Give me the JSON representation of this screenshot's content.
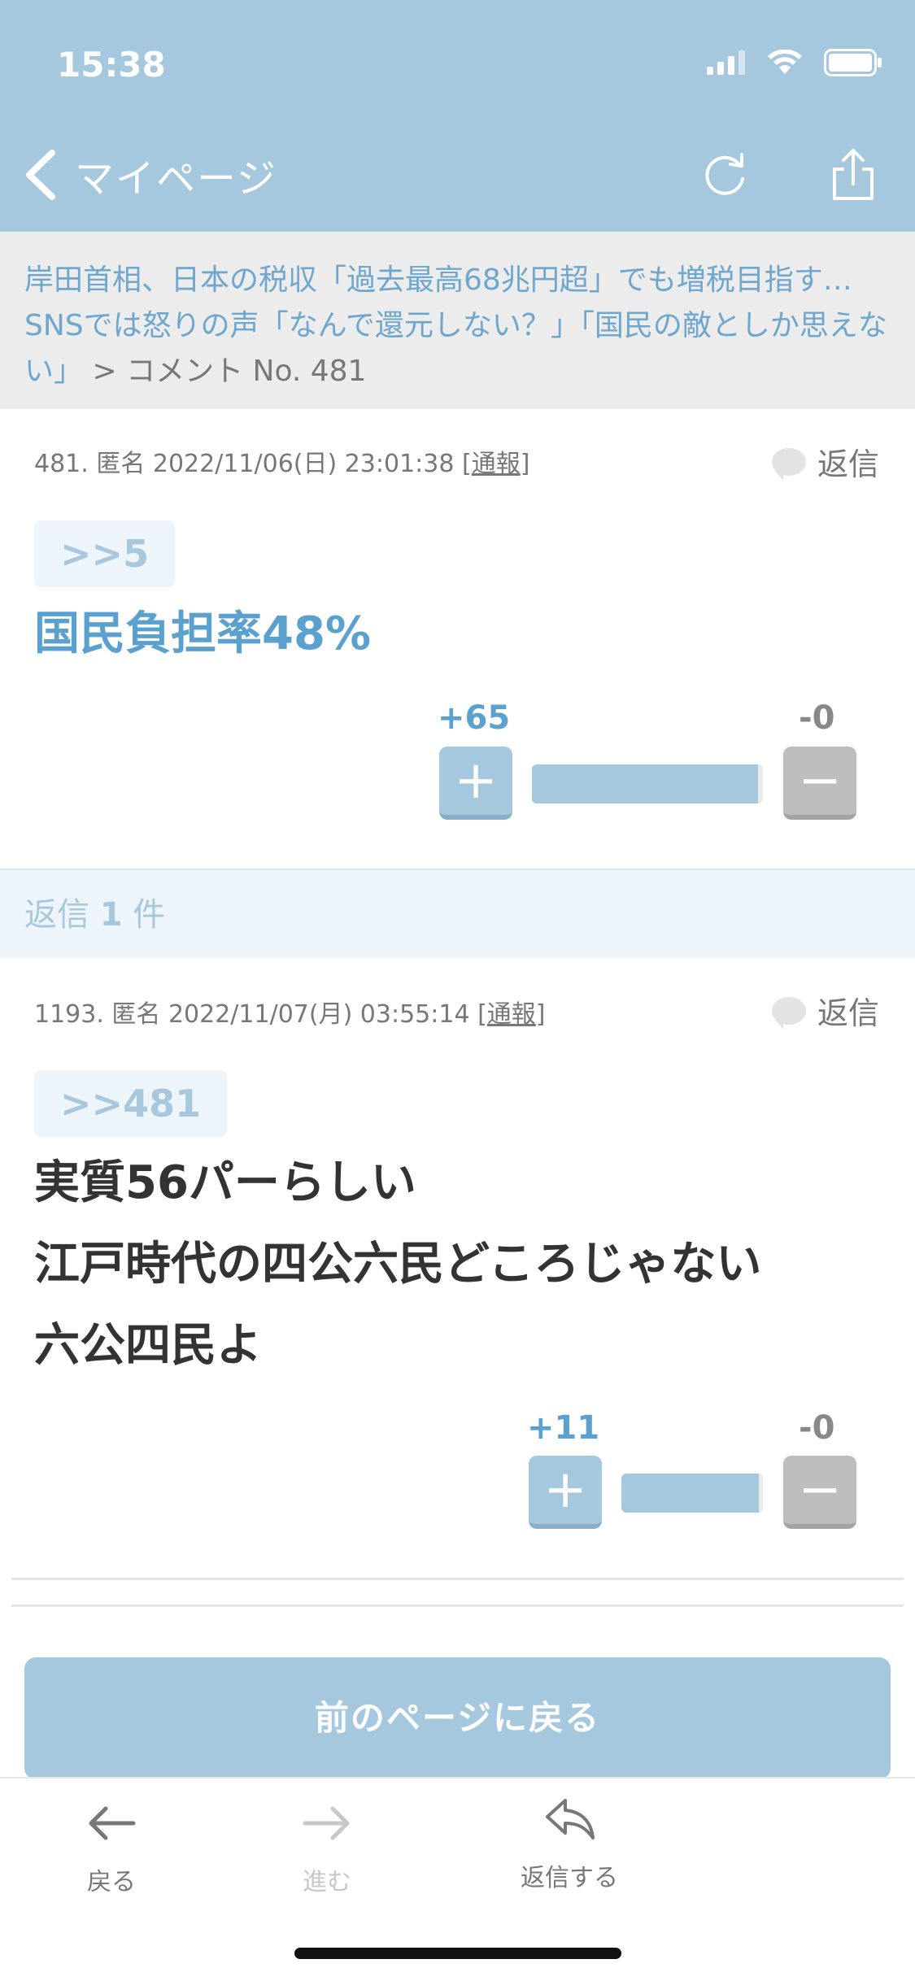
{
  "status_bar": {
    "time": "15:38"
  },
  "nav": {
    "back_label": "マイページ"
  },
  "breadcrumb": {
    "link_text": "岸田首相、日本の税収「過去最高68兆円超」でも増税目指す… SNSでは怒りの声「なんで還元しない？」「国民の敵としか思えない」",
    "rest_text": " > コメント No. 481"
  },
  "comment": {
    "meta_prefix": "481. 匿名 2022/11/06(日) 23:01:38 [",
    "report_label": "通報",
    "meta_suffix": "]",
    "reply_label": "返信",
    "anchor": ">>5",
    "body": "国民負担率48%",
    "plus_count": "+65",
    "minus_count": "-0",
    "plus_symbol": "+",
    "minus_symbol": "−",
    "plus_ratio": 1.0
  },
  "replies_header": {
    "prefix": "返信 ",
    "count": "1",
    "suffix": " 件"
  },
  "reply": {
    "meta_prefix": "1193. 匿名 2022/11/07(月) 03:55:14 [",
    "report_label": "通報",
    "meta_suffix": "]",
    "reply_label": "返信",
    "anchor": ">>481",
    "body_lines": [
      "実質56パーらしい",
      "江戸時代の四公六民どころじゃない",
      "六公四民よ"
    ],
    "plus_count": "+11",
    "minus_count": "-0",
    "plus_symbol": "+",
    "minus_symbol": "−",
    "plus_ratio": 1.0
  },
  "prev_page_label": "前のページに戻る",
  "tabbar": {
    "back": "戻る",
    "forward": "進む",
    "reply": "返信する"
  },
  "colors": {
    "accent": "#a5c8df",
    "link": "#5aa1d0",
    "breadcrumb_bg": "#ececec"
  }
}
